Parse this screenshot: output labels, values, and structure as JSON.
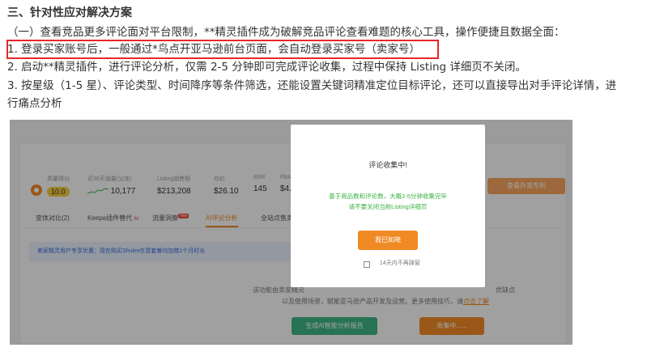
{
  "document": {
    "heading": "三、针对性应对解决方案",
    "lines": [
      "（一）查看竞品更多评论面对平台限制，**精灵插件成为破解竞品评论查看难题的核心工具，操作便捷且数据全面：",
      "1. 登录买家账号后，一般通过*鸟点开亚马逊前台页面，会自动登录买家号（卖家号）",
      "2. 启动**精灵插件，进行评论分析，仅需 2-5 分钟即可完成评论收集，过程中保持 Listing 详细页不关闭。",
      "3. 按星级（1-5 星）、评论类型、时间降序等条件筛选，还能设置关键词精准定位目标评论，还可以直接导出对手评论详情，进",
      "行痛点分析"
    ],
    "highlight_color": "#e8262a"
  },
  "screenshot": {
    "stats": [
      {
        "label": "质量得分",
        "value": "10.0"
      },
      {
        "label": "近30天销量(父体)",
        "value": "10,177"
      },
      {
        "label": "Listing销售额",
        "value": "$213,208"
      },
      {
        "label": "均价",
        "value": "$26.10"
      },
      {
        "label": "BSR",
        "value": "145"
      },
      {
        "label": "FBA",
        "value": "$4."
      }
    ],
    "right_button": "查看外观专利",
    "tabs": [
      {
        "label": "变体对比(2)"
      },
      {
        "label": "Keepa插件替代"
      },
      {
        "label": "流量洞察"
      },
      {
        "label": "AI评论分析"
      },
      {
        "label": "全站点售卖"
      }
    ],
    "hot_badge": "new",
    "ai_badge": "AI",
    "promo_banner": "卖家精灵用户专享优惠：现在购买Shulex任意套餐均加赠1个月时长",
    "bg_line1": "该功能由卖家精灵",
    "bg_line1_end": "优缺点",
    "bg_line2": "以及使用场景，赋能亚马逊产品开发及运营。更多使用技巧，请",
    "bg_link": "点击了解",
    "green_button": "生成AI智能分析报告",
    "orange_button": "收集中......",
    "modal": {
      "title": "评论收集中!",
      "body_line1": "基于商品数和评论数，大概2-5分钟收集完毕",
      "body_line2": "请不要关闭当前Listing详细页",
      "button": "我已知晓",
      "checkbox_label": "14天内不再弹窗"
    },
    "colors": {
      "accent_orange": "#f08a24",
      "modal_text_green": "#3cb043",
      "green_button": "#3fb586",
      "promo_text": "#3a6fd8"
    }
  }
}
